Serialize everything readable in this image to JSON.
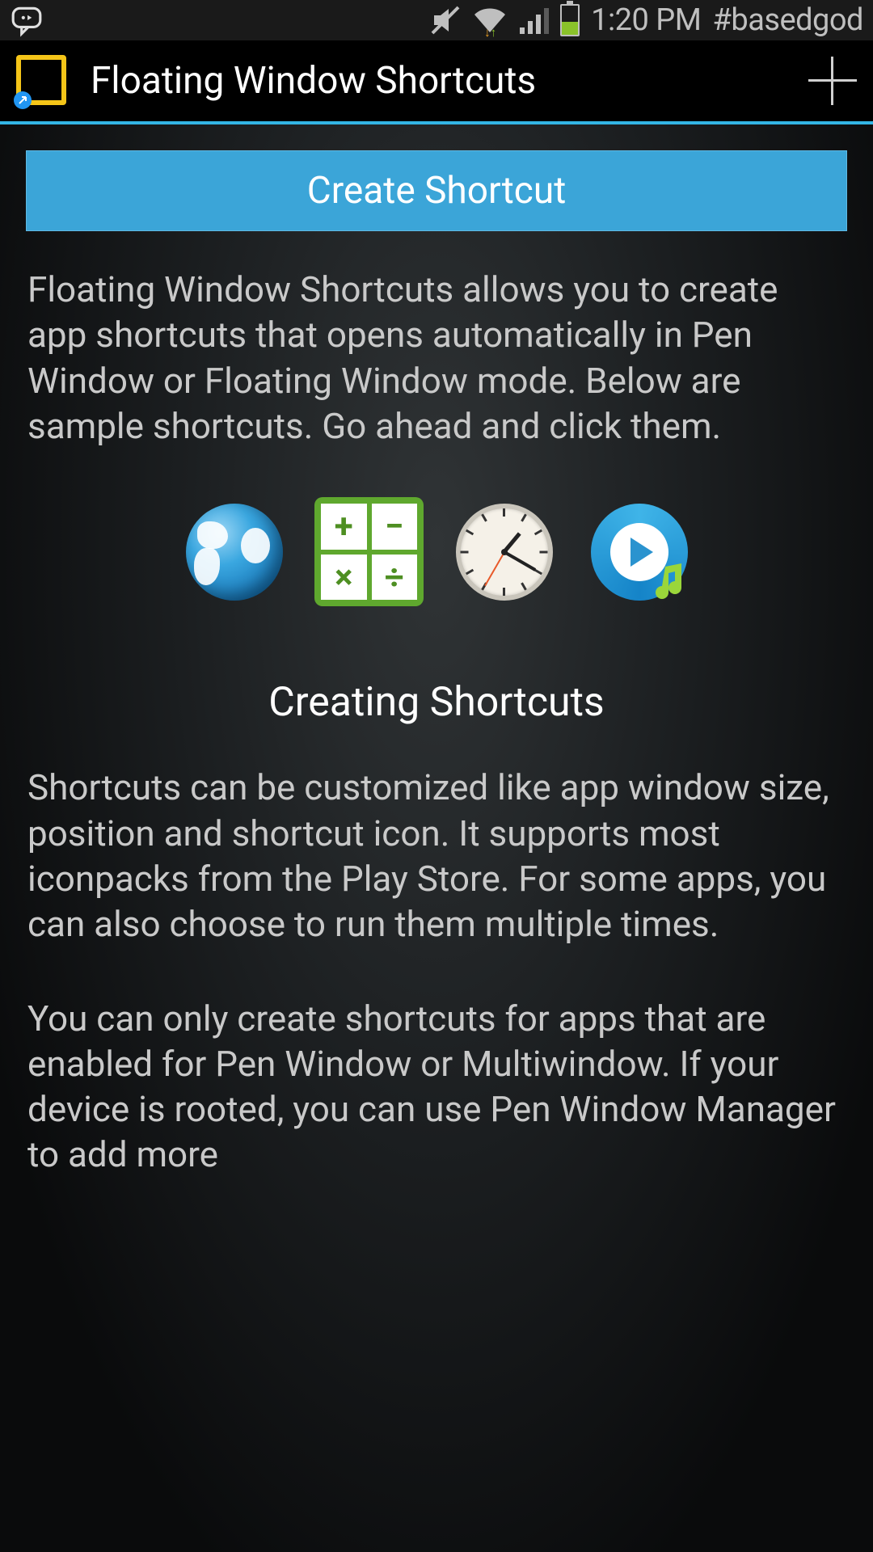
{
  "status_bar": {
    "time": "1:20 PM",
    "extra_text": "#basedgod"
  },
  "action_bar": {
    "title": "Floating Window Shortcuts"
  },
  "main": {
    "create_button": "Create Shortcut",
    "intro_text": "Floating Window Shortcuts allows you to create app shortcuts that opens automatically in Pen Window or Floating Window mode. Below are sample shortcuts. Go ahead and click them.",
    "samples": {
      "browser": "Browser",
      "calculator": "Calculator",
      "clock": "Clock",
      "music": "Music Player"
    },
    "section_title": "Creating Shortcuts",
    "para1": "Shortcuts can be customized like app window size, position and shortcut icon. It supports most iconpacks from the Play Store. For some apps, you can also choose to run them multiple times.",
    "para2": "You can only create shortcuts for apps that are enabled for Pen Window or Multiwindow. If your device is rooted, you can use Pen Window Manager to add more"
  }
}
